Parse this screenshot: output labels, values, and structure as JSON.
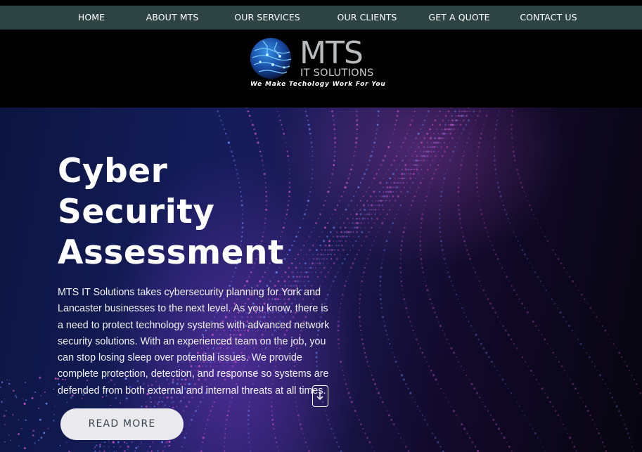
{
  "nav": {
    "items": [
      {
        "label": "HOME"
      },
      {
        "label": "ABOUT MTS"
      },
      {
        "label": "OUR SERVICES"
      },
      {
        "label": "OUR CLIENTS"
      },
      {
        "label": "GET A QUOTE"
      },
      {
        "label": "CONTACT US"
      }
    ],
    "background": "#2e4444"
  },
  "logo": {
    "name": "MTS",
    "subtitle": "IT SOLUTIONS",
    "tagline": "We Make Techology Work For You",
    "icon": "circuit-globe-icon"
  },
  "hero": {
    "title_lines": [
      "Cyber",
      "Security",
      "Assessment"
    ],
    "body": "MTS IT Solutions takes cybersecurity planning for York and Lancaster businesses to the next level. As you know, there is a need to protect technology systems with advanced network security solutions. With an experienced team on the job, you can stop losing sleep over potential issues. We provide complete protection, detection, and response so systems are defended from both external and internal threats at all times.",
    "cta_label": "READ MORE",
    "scroll_icon": "arrow-down-icon"
  },
  "colors": {
    "accent": "#2e4444",
    "hero_dark": "#141c5a",
    "particle_pink": "#e05ad8",
    "particle_blue": "#6a8cff"
  }
}
